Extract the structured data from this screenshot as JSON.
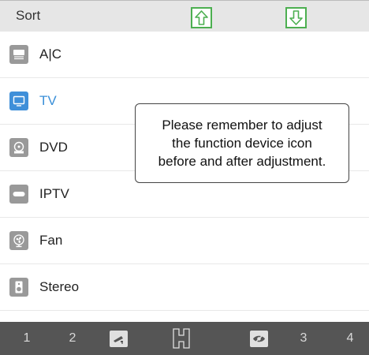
{
  "header": {
    "title": "Sort"
  },
  "devices": [
    {
      "label": "A|C",
      "icon": "ac-icon",
      "active": false
    },
    {
      "label": "TV",
      "icon": "tv-icon",
      "active": true
    },
    {
      "label": "DVD",
      "icon": "dvd-icon",
      "active": false
    },
    {
      "label": "IPTV",
      "icon": "iptv-icon",
      "active": false
    },
    {
      "label": "Fan",
      "icon": "fan-icon",
      "active": false
    },
    {
      "label": "Stereo",
      "icon": "stereo-icon",
      "active": false
    }
  ],
  "tooltip": {
    "line1": "Please remember to adjust",
    "line2": "the function device icon",
    "line3": "before and after adjustment."
  },
  "bottom_bar": {
    "item1": "1",
    "item2": "2",
    "item3": "3",
    "item4": "4"
  },
  "colors": {
    "accent_green": "#4caf50",
    "accent_blue": "#3a8fd8",
    "bottom_bar_bg": "#555555"
  }
}
